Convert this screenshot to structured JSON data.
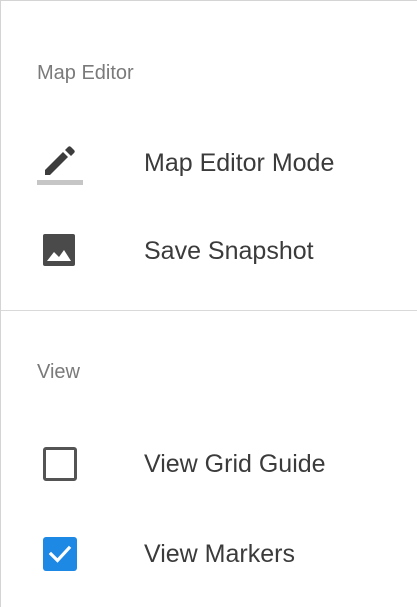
{
  "sections": {
    "map_editor": {
      "header": "Map Editor",
      "items": [
        {
          "label": "Map Editor Mode",
          "icon": "pencil-icon"
        },
        {
          "label": "Save Snapshot",
          "icon": "image-icon"
        }
      ]
    },
    "view": {
      "header": "View",
      "items": [
        {
          "label": "View Grid Guide",
          "icon": "checkbox-unchecked-icon",
          "checked": false
        },
        {
          "label": "View Markers",
          "icon": "checkbox-checked-icon",
          "checked": true
        }
      ]
    }
  },
  "colors": {
    "checkbox_checked": "#1e88e5",
    "text": "#3b3b3b",
    "header_text": "#7a7a7a",
    "pencil_underline": "#c6c6c6"
  }
}
